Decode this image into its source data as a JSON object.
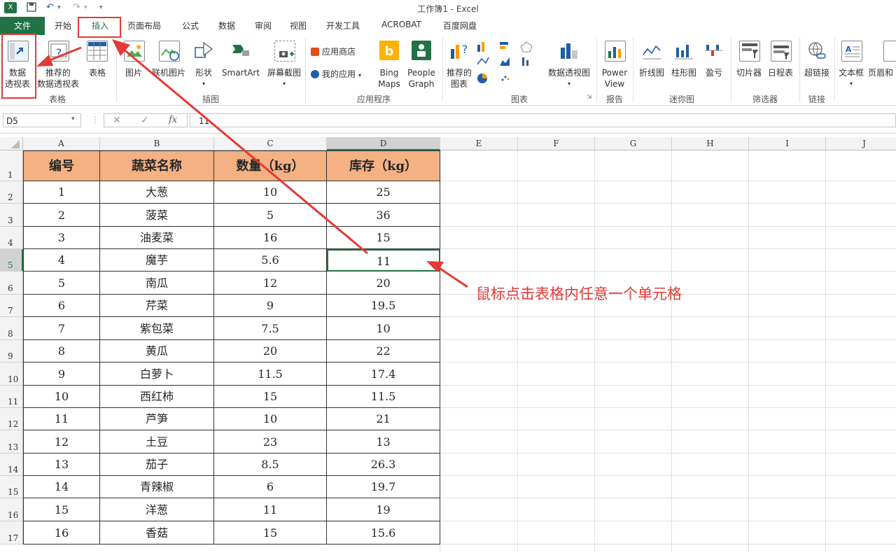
{
  "window": {
    "title": "工作簿1 - Excel"
  },
  "tabs": [
    "文件",
    "开始",
    "插入",
    "页面布局",
    "公式",
    "数据",
    "审阅",
    "视图",
    "开发工具",
    "ACROBAT",
    "百度网盘"
  ],
  "active_tab": "插入",
  "ribbon": {
    "pivot": {
      "line1": "数据",
      "line2": "透视表"
    },
    "recommended_pivot": {
      "line1": "推荐的",
      "line2": "数据透视表"
    },
    "table": "表格",
    "group_tables": "表格",
    "picture": "图片",
    "online_picture": "联机图片",
    "shapes": "形状",
    "smartart": "SmartArt",
    "screenshot": "屏幕截图",
    "group_illustrations": "插图",
    "app_store": "应用商店",
    "my_apps": "我的应用",
    "bing_maps": {
      "line1": "Bing",
      "line2": "Maps"
    },
    "people_graph": {
      "line1": "People",
      "line2": "Graph"
    },
    "group_apps": "应用程序",
    "recommended_charts": {
      "line1": "推荐的",
      "line2": "图表"
    },
    "pivot_chart": "数据透视图",
    "group_charts": "图表",
    "power_view": {
      "line1": "Power",
      "line2": "View"
    },
    "group_reports": "报告",
    "spark_line": "折线图",
    "spark_column": "柱形图",
    "spark_winloss": "盈亏",
    "group_sparklines": "迷你图",
    "slicer": "切片器",
    "timeline": "日程表",
    "group_filters": "筛选器",
    "hyperlink": "超链接",
    "group_links": "链接",
    "textbox": "文本框",
    "header_footer": "页眉和"
  },
  "formula_bar": {
    "name_box": "D5",
    "fx": "fx",
    "formula": "11"
  },
  "columns": [
    "A",
    "B",
    "C",
    "D",
    "E",
    "F",
    "G",
    "H",
    "I",
    "J"
  ],
  "rows": [
    "1",
    "2",
    "3",
    "4",
    "5",
    "6",
    "7",
    "8",
    "9",
    "10",
    "11",
    "12",
    "13",
    "14",
    "15",
    "16",
    "17"
  ],
  "table": {
    "headers": [
      "编号",
      "蔬菜名称",
      "数量（kg）",
      "库存（kg）"
    ],
    "data": [
      [
        "1",
        "大葱",
        "10",
        "25"
      ],
      [
        "2",
        "菠菜",
        "5",
        "36"
      ],
      [
        "3",
        "油麦菜",
        "16",
        "15"
      ],
      [
        "4",
        "魔芋",
        "5.6",
        "11"
      ],
      [
        "5",
        "南瓜",
        "12",
        "20"
      ],
      [
        "6",
        "芹菜",
        "9",
        "19.5"
      ],
      [
        "7",
        "紫包菜",
        "7.5",
        "10"
      ],
      [
        "8",
        "黄瓜",
        "20",
        "22"
      ],
      [
        "9",
        "白萝卜",
        "11.5",
        "17.4"
      ],
      [
        "10",
        "西红柿",
        "15",
        "11.5"
      ],
      [
        "11",
        "芦笋",
        "10",
        "21"
      ],
      [
        "12",
        "土豆",
        "23",
        "13"
      ],
      [
        "13",
        "茄子",
        "8.5",
        "26.3"
      ],
      [
        "14",
        "青辣椒",
        "6",
        "19.7"
      ],
      [
        "15",
        "洋葱",
        "11",
        "19"
      ],
      [
        "16",
        "香菇",
        "15",
        "15.6"
      ]
    ]
  },
  "selected_cell": "D5",
  "annotation": {
    "text": "鼠标点击表格内任意一个单元格",
    "color": "#e53935"
  },
  "colors": {
    "excel_green": "#217346",
    "header_fill": "#f4b183",
    "annotation_red": "#e53935"
  }
}
